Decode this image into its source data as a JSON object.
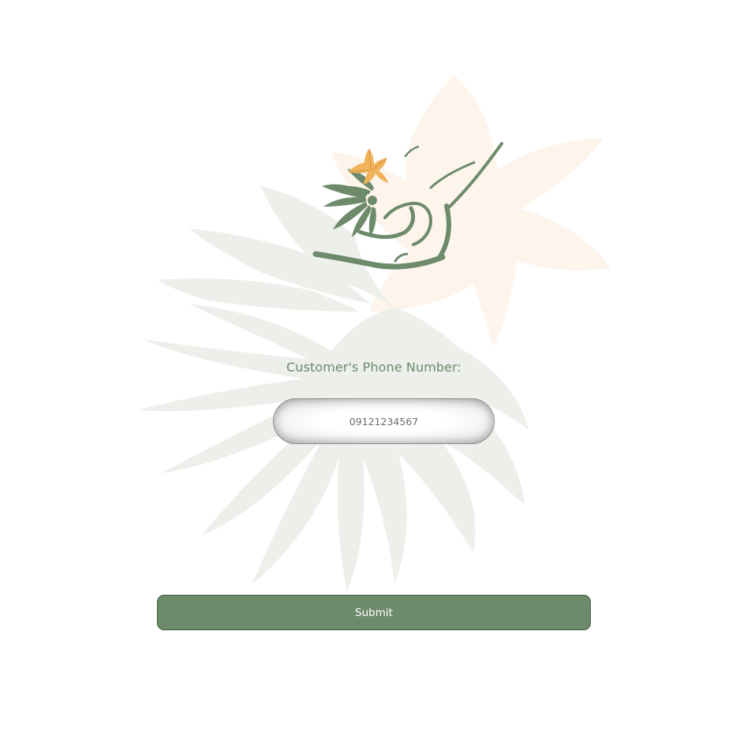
{
  "form": {
    "phone_label": "Customer's Phone Number:",
    "phone_value": "09121234567",
    "submit_label": "Submit"
  },
  "colors": {
    "brand_green": "#6d8b6b",
    "label_green": "#6d8b6c",
    "accent_orange": "#f0b35a",
    "watermark_green": "#ecefea",
    "watermark_peach": "#fdf5ec"
  },
  "icons": {
    "background": "leaf-flower-watermark",
    "logo": "brand-logo-palm-flower"
  }
}
